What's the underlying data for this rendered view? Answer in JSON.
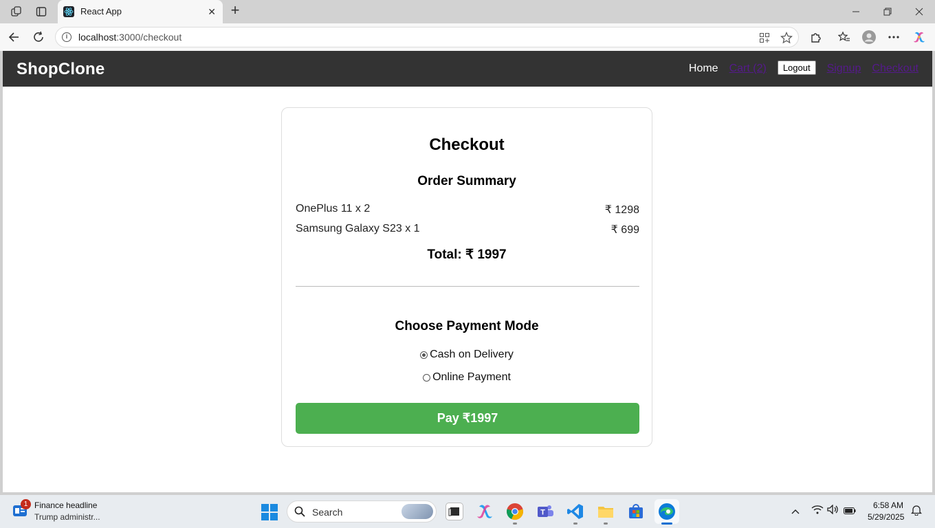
{
  "browser": {
    "tab_title": "React App",
    "url_host": "localhost",
    "url_rest": ":3000/checkout"
  },
  "navbar": {
    "brand": "ShopClone",
    "home": "Home",
    "cart": "Cart (2)",
    "logout": "Logout",
    "signup": "Signup",
    "checkout": "Checkout"
  },
  "checkout": {
    "title": "Checkout",
    "summary_title": "Order Summary",
    "items": [
      {
        "name": "OnePlus 11 x 2",
        "price": "₹ 1298"
      },
      {
        "name": "Samsung Galaxy S23 x 1",
        "price": "₹ 699"
      }
    ],
    "total": "Total: ₹ 1997",
    "payment_title": "Choose Payment Mode",
    "payment_options": [
      {
        "label": "Cash on Delivery",
        "checked": true
      },
      {
        "label": "Online Payment",
        "checked": false
      }
    ],
    "pay_button": "Pay ₹1997"
  },
  "colors": {
    "navbar_bg": "#333333",
    "pay_button": "#4caf50",
    "visited_link": "#551a8b"
  },
  "taskbar": {
    "news_badge": "1",
    "news_title": "Finance headline",
    "news_subtitle": "Trump administr...",
    "search_placeholder": "Search",
    "time": "6:58 AM",
    "date": "5/29/2025"
  }
}
